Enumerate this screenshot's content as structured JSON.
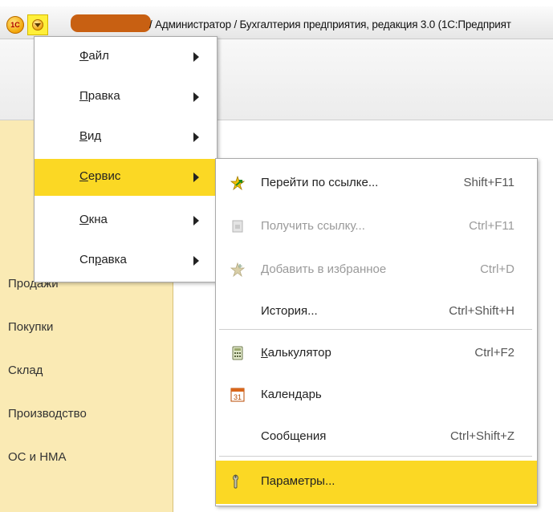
{
  "window": {
    "logo": "1С",
    "title": "/ Администратор / Бухгалтерия предприятия, редакция 3.0  (1С:Предприят"
  },
  "sections": [
    {
      "label": "Продажи"
    },
    {
      "label": "Покупки"
    },
    {
      "label": "Склад"
    },
    {
      "label": "Производство"
    },
    {
      "label": "ОС и НМА"
    }
  ],
  "main_menu": [
    {
      "pre": "",
      "ul": "Ф",
      "post": "айл"
    },
    {
      "pre": "",
      "ul": "П",
      "post": "равка"
    },
    {
      "pre": "",
      "ul": "В",
      "post": "ид"
    },
    {
      "pre": "",
      "ul": "С",
      "post": "ервис"
    },
    {
      "pre": "",
      "ul": "О",
      "post": "кна"
    },
    {
      "pre": "Сп",
      "ul": "р",
      "post": "авка"
    }
  ],
  "service_menu": [
    {
      "label": "Перейти по ссылке...",
      "shortcut": "Shift+F11",
      "icon": "star-arrow-icon"
    },
    {
      "label": "Получить ссылку...",
      "shortcut": "Ctrl+F11",
      "icon": "link-doc-icon"
    },
    {
      "label": "Добавить в избранное",
      "shortcut": "Ctrl+D",
      "icon": "star-plus-icon"
    },
    {
      "label": "История...",
      "shortcut": "Ctrl+Shift+H",
      "icon": ""
    },
    {
      "pre": "",
      "ul": "К",
      "post": "алькулятор",
      "shortcut": "Ctrl+F2",
      "icon": "calculator-icon"
    },
    {
      "pre": "Кален",
      "ul": "д",
      "post": "арь",
      "shortcut": "",
      "icon": "calendar-icon",
      "icon_text": "31"
    },
    {
      "label": "Сообщения",
      "shortcut": "Ctrl+Shift+Z",
      "icon": ""
    },
    {
      "label": "Параметры...",
      "shortcut": "",
      "icon": "wrench-icon"
    }
  ],
  "colors": {
    "highlight": "#fbd824",
    "section_panel": "#faeab4",
    "redacted": "#c86012"
  }
}
